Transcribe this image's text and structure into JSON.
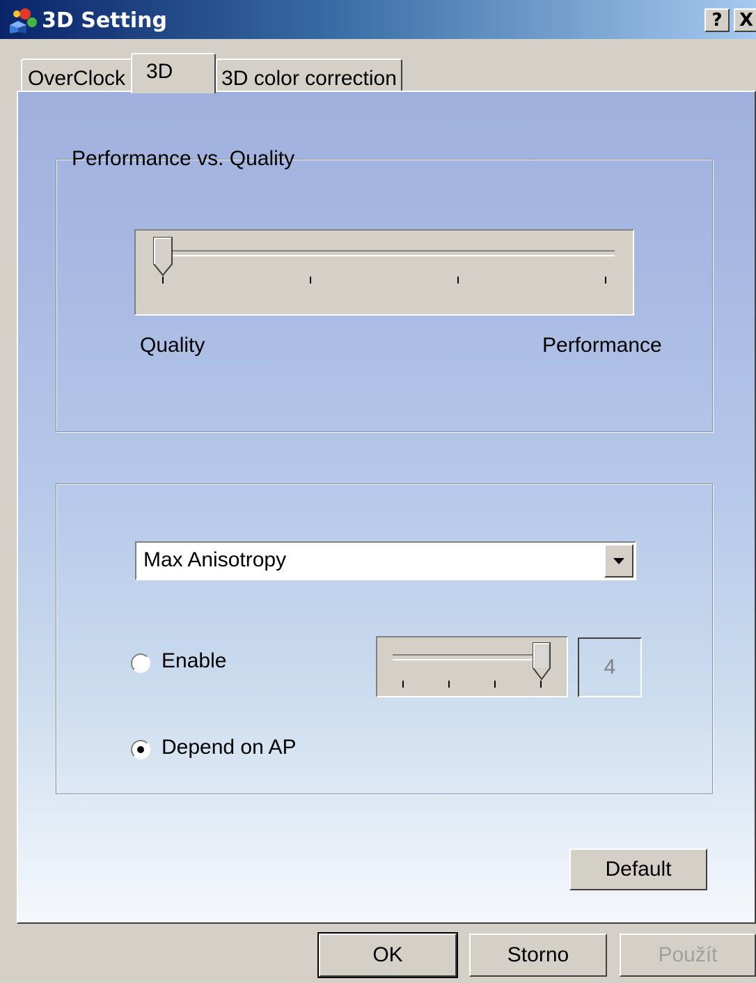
{
  "window": {
    "title": "3D Setting",
    "help_glyph": "?",
    "close_glyph": "X"
  },
  "tabs": [
    {
      "label": "OverClock",
      "selected": false
    },
    {
      "label": "3D",
      "selected": true
    },
    {
      "label": "3D color correction",
      "selected": false
    }
  ],
  "perf_group": {
    "legend": "Performance vs. Quality",
    "slider": {
      "min_label": "Quality",
      "max_label": "Performance",
      "ticks": 4,
      "position_index": 0
    }
  },
  "aniso_group": {
    "combo_value": "Max Anisotropy",
    "radios": [
      {
        "label": "Enable",
        "checked": false
      },
      {
        "label": "Depend on AP",
        "checked": true
      }
    ],
    "slider": {
      "ticks": 4,
      "position_index": 3
    },
    "value_display": "4"
  },
  "buttons": {
    "default": "Default",
    "ok": "OK",
    "cancel": "Storno",
    "apply": "Použít"
  }
}
